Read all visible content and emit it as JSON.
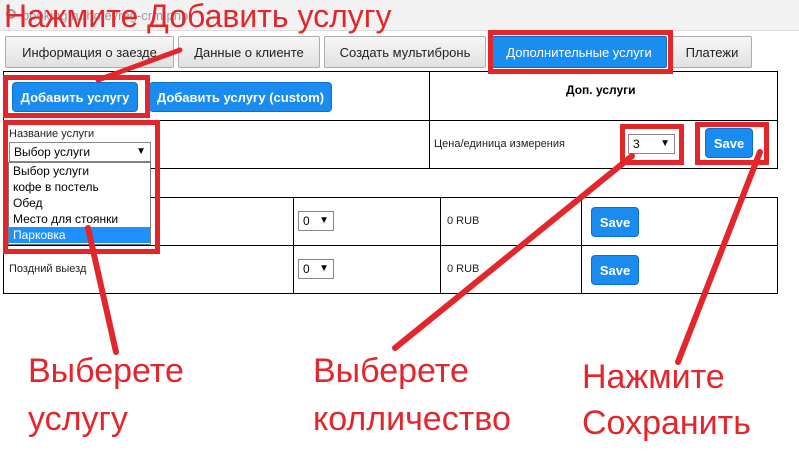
{
  "browser": {
    "url": "booking.ru/hotel/reg-crm.php"
  },
  "tabs": [
    {
      "label": "Информация о заезде"
    },
    {
      "label": "Данные о клиенте"
    },
    {
      "label": "Создать мультибронь"
    },
    {
      "label": "Дополнительные услуги"
    },
    {
      "label": "Платежи"
    }
  ],
  "panel": {
    "add_service_label": "Добавить услугу",
    "add_service_custom_label": "Добавить услугу (custom)",
    "section_title": "Доп. услуги",
    "service_name_label": "Название услуги",
    "service_select_value": "Выбор услуги",
    "price_unit_label": "Цена/единица измерения",
    "qty_value": "3",
    "save_label": "Save",
    "dropdown_options": [
      {
        "label": "Выбор услуги"
      },
      {
        "label": "кофе в постель"
      },
      {
        "label": "Обед"
      },
      {
        "label": "Место для стоянки"
      },
      {
        "label": "Парковка",
        "selected": true
      }
    ]
  },
  "rows": [
    {
      "name": "",
      "qty": "0",
      "price": "0 RUB",
      "save_label": "Save"
    },
    {
      "name": "Поздний выезд",
      "qty": "0",
      "price": "0 RUB",
      "save_label": "Save"
    }
  ],
  "annotations": {
    "click_add": "Нажмите Добавить услугу",
    "choose_service_line1": "Выберете",
    "choose_service_line2": "услугу",
    "choose_qty_line1": "Выберете",
    "choose_qty_line2": "колличество",
    "click_save_line1": "Нажмите",
    "click_save_line2": "Сохранить"
  },
  "colors": {
    "annotation": "#e3262b",
    "accent": "#1a8cf0"
  }
}
